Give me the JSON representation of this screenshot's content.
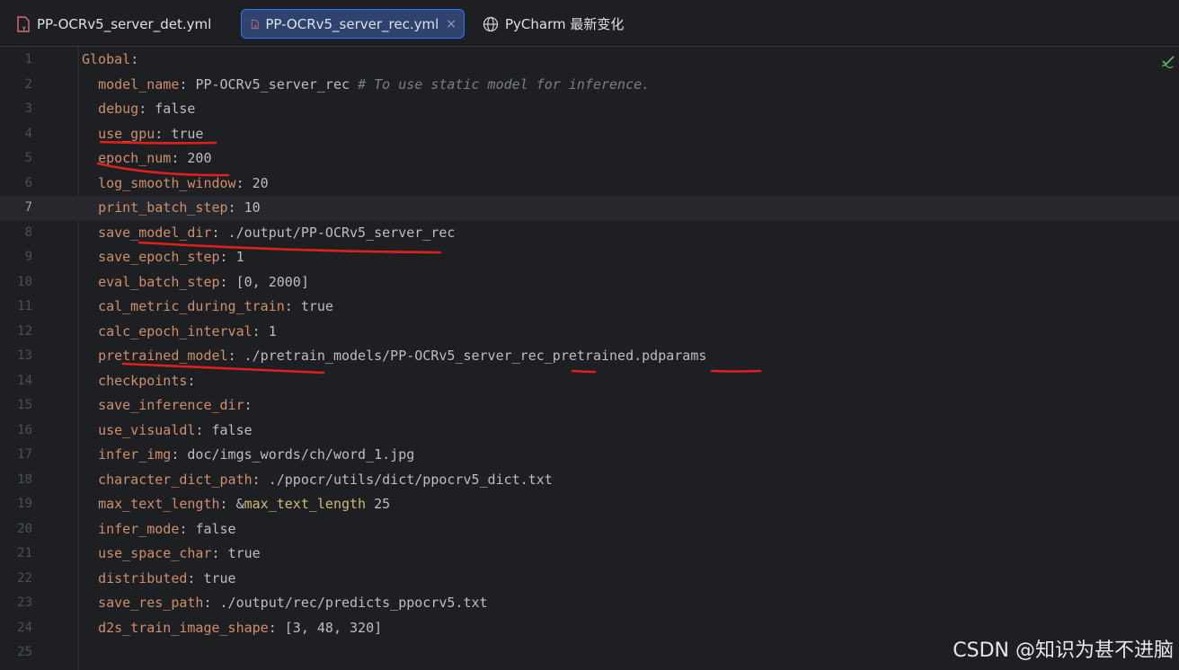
{
  "tabs": [
    {
      "label": "PP-OCRv5_server_det.yml",
      "active": false,
      "icon": "yaml-file-icon"
    },
    {
      "label": "PP-OCRv5_server_rec.yml",
      "active": true,
      "icon": "yaml-file-icon"
    },
    {
      "label": "PyCharm 最新变化",
      "active": false,
      "icon": "globe-icon"
    }
  ],
  "tab_close_glyph": "×",
  "colors": {
    "background": "#1e1f22",
    "key": "#cf8e6d",
    "value": "#bcbec4",
    "comment": "#7a7e85",
    "anchor": "#d5b778",
    "active_tab": "#2e436e",
    "annotation_underline": "#e0201d",
    "inspection_ok": "#5fb865"
  },
  "editor": {
    "current_line": 7,
    "lines": [
      {
        "n": "1",
        "indent": "",
        "key": "Global",
        "sep": ":",
        "value": "",
        "comment": "",
        "anchor": ""
      },
      {
        "n": "2",
        "indent": "  ",
        "key": "model_name",
        "sep": ": ",
        "value": "PP-OCRv5_server_rec ",
        "comment": "# To use static model for inference.",
        "anchor": ""
      },
      {
        "n": "3",
        "indent": "  ",
        "key": "debug",
        "sep": ": ",
        "value": "false",
        "comment": "",
        "anchor": ""
      },
      {
        "n": "4",
        "indent": "  ",
        "key": "use_gpu",
        "sep": ": ",
        "value": "true",
        "comment": "",
        "anchor": ""
      },
      {
        "n": "5",
        "indent": "  ",
        "key": "epoch_num",
        "sep": ": ",
        "value": "200",
        "comment": "",
        "anchor": ""
      },
      {
        "n": "6",
        "indent": "  ",
        "key": "log_smooth_window",
        "sep": ": ",
        "value": "20",
        "comment": "",
        "anchor": ""
      },
      {
        "n": "7",
        "indent": "  ",
        "key": "print_batch_step",
        "sep": ": ",
        "value": "10",
        "comment": "",
        "anchor": ""
      },
      {
        "n": "8",
        "indent": "  ",
        "key": "save_model_dir",
        "sep": ": ",
        "value": "./output/PP-OCRv5_server_rec",
        "comment": "",
        "anchor": ""
      },
      {
        "n": "9",
        "indent": "  ",
        "key": "save_epoch_step",
        "sep": ": ",
        "value": "1",
        "comment": "",
        "anchor": ""
      },
      {
        "n": "10",
        "indent": "  ",
        "key": "eval_batch_step",
        "sep": ": ",
        "value": "[0, 2000]",
        "comment": "",
        "anchor": ""
      },
      {
        "n": "11",
        "indent": "  ",
        "key": "cal_metric_during_train",
        "sep": ": ",
        "value": "true",
        "comment": "",
        "anchor": ""
      },
      {
        "n": "12",
        "indent": "  ",
        "key": "calc_epoch_interval",
        "sep": ": ",
        "value": "1",
        "comment": "",
        "anchor": ""
      },
      {
        "n": "13",
        "indent": "  ",
        "key": "pretrained_model",
        "sep": ": ",
        "value": "./pretrain_models/PP-OCRv5_server_rec_pretrained.pdparams",
        "comment": "",
        "anchor": ""
      },
      {
        "n": "14",
        "indent": "  ",
        "key": "checkpoints",
        "sep": ":",
        "value": "",
        "comment": "",
        "anchor": ""
      },
      {
        "n": "15",
        "indent": "  ",
        "key": "save_inference_dir",
        "sep": ":",
        "value": "",
        "comment": "",
        "anchor": ""
      },
      {
        "n": "16",
        "indent": "  ",
        "key": "use_visualdl",
        "sep": ": ",
        "value": "false",
        "comment": "",
        "anchor": ""
      },
      {
        "n": "17",
        "indent": "  ",
        "key": "infer_img",
        "sep": ": ",
        "value": "doc/imgs_words/ch/word_1.jpg",
        "comment": "",
        "anchor": ""
      },
      {
        "n": "18",
        "indent": "  ",
        "key": "character_dict_path",
        "sep": ": ",
        "value": "./ppocr/utils/dict/ppocrv5_dict.txt",
        "comment": "",
        "anchor": ""
      },
      {
        "n": "19",
        "indent": "  ",
        "key": "max_text_length",
        "sep": ": &",
        "value": " 25",
        "comment": "",
        "anchor": "max_text_length"
      },
      {
        "n": "20",
        "indent": "  ",
        "key": "infer_mode",
        "sep": ": ",
        "value": "false",
        "comment": "",
        "anchor": ""
      },
      {
        "n": "21",
        "indent": "  ",
        "key": "use_space_char",
        "sep": ": ",
        "value": "true",
        "comment": "",
        "anchor": ""
      },
      {
        "n": "22",
        "indent": "  ",
        "key": "distributed",
        "sep": ": ",
        "value": "true",
        "comment": "",
        "anchor": ""
      },
      {
        "n": "23",
        "indent": "  ",
        "key": "save_res_path",
        "sep": ": ",
        "value": "./output/rec/predicts_ppocrv5.txt",
        "comment": "",
        "anchor": ""
      },
      {
        "n": "24",
        "indent": "  ",
        "key": "d2s_train_image_shape",
        "sep": ": ",
        "value": "[3, 48, 320]",
        "comment": "",
        "anchor": ""
      },
      {
        "n": "25",
        "indent": "",
        "key": "",
        "sep": "",
        "value": "",
        "comment": "",
        "anchor": ""
      }
    ]
  },
  "watermark": "CSDN @知识为甚不进脑"
}
